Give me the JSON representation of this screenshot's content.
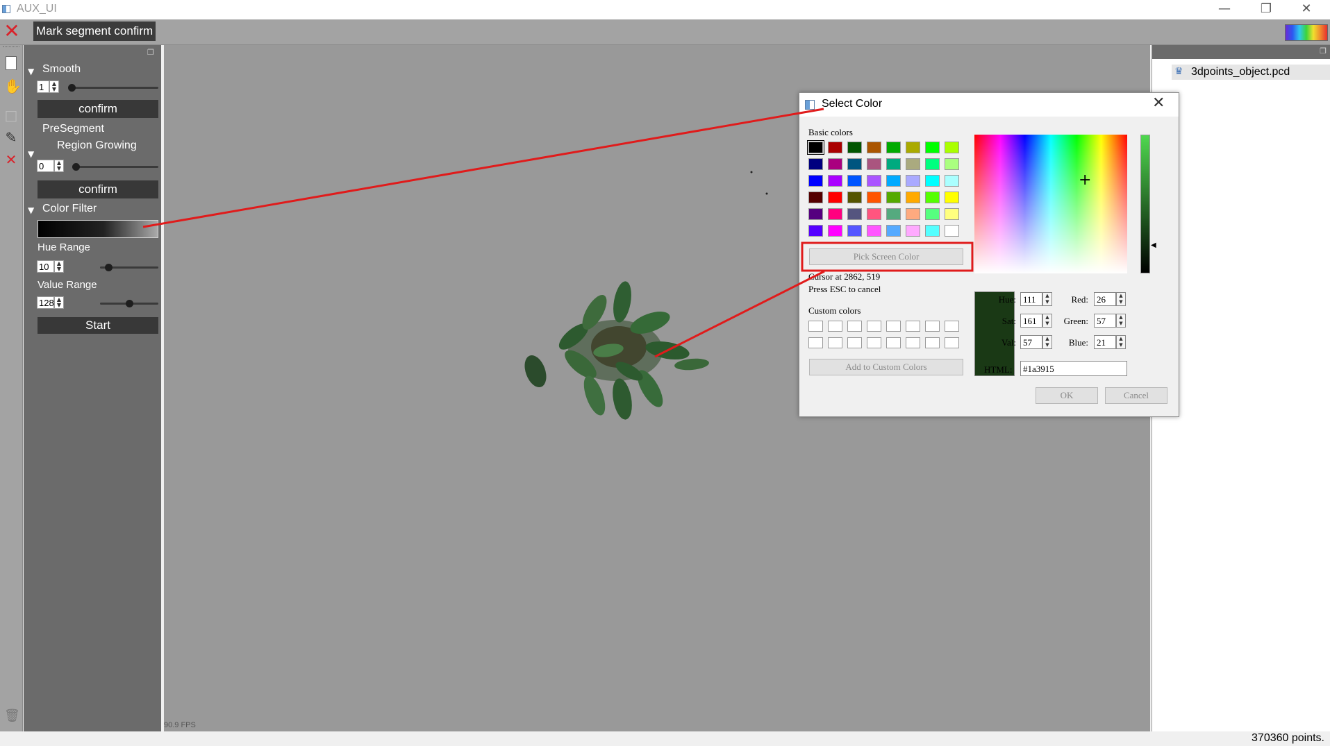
{
  "window": {
    "title": "AUX_UI",
    "minimize_icon": "minimize-icon",
    "maximize_icon": "restore-icon",
    "close_icon": "close-icon"
  },
  "toolbar": {
    "close_icon": "close-icon",
    "mark_label": "Mark segment confirm",
    "colormap_icon": "rainbow-colormap-icon"
  },
  "left_panel": {
    "smooth": {
      "title": "Smooth",
      "value": "1",
      "button": "confirm",
      "slider_fraction": 0.0
    },
    "presegment": {
      "title": "PreSegment",
      "method": "Region Growing",
      "value": "0",
      "button": "confirm",
      "slider_fraction": 0.0
    },
    "color_filter": {
      "title": "Color Filter",
      "hue_label": "Hue Range",
      "hue_value": "10",
      "hue_fraction": 0.1,
      "value_label": "Value Range",
      "value_value": "128",
      "value_fraction": 0.5,
      "start_button": "Start"
    }
  },
  "viewport": {
    "fps": "90.9 FPS"
  },
  "right_panel": {
    "file_name": "3dpoints_object.pcd"
  },
  "status": {
    "points": "370360 points."
  },
  "dialog": {
    "title": "Select Color",
    "basic_colors_label": "Basic colors",
    "basic_colors": [
      "#000000",
      "#aa0000",
      "#005500",
      "#aa5500",
      "#00aa00",
      "#aaaa00",
      "#00ff00",
      "#aaff00",
      "#00007f",
      "#aa007f",
      "#00557f",
      "#aa557f",
      "#00aa7f",
      "#aaaa7f",
      "#00ff7f",
      "#aaff7f",
      "#0000ff",
      "#aa00ff",
      "#0055ff",
      "#aa55ff",
      "#00aaff",
      "#aaaaff",
      "#00ffff",
      "#aaffff",
      "#550000",
      "#ff0000",
      "#555500",
      "#ff5500",
      "#55aa00",
      "#ffaa00",
      "#55ff00",
      "#ffff00",
      "#55007f",
      "#ff007f",
      "#55557f",
      "#ff557f",
      "#55aa7f",
      "#ffaa7f",
      "#55ff7f",
      "#ffff7f",
      "#5500ff",
      "#ff00ff",
      "#5555ff",
      "#ff55ff",
      "#55aaff",
      "#ffaaff",
      "#55ffff",
      "#ffffff"
    ],
    "pick_screen_label": "Pick Screen Color",
    "cursor_text": "Cursor at 2862, 519",
    "esc_text": "Press ESC to cancel",
    "custom_colors_label": "Custom colors",
    "add_custom_label": "Add to Custom Colors",
    "hue_label": "Hue:",
    "hue": "111",
    "sat_label": "Sat:",
    "sat": "161",
    "val_label": "Val:",
    "val": "57",
    "red_label": "Red:",
    "red": "26",
    "green_label": "Green:",
    "green": "57",
    "blue_label": "Blue:",
    "blue": "21",
    "html_label": "HTML:",
    "html": "#1a3915",
    "ok_label": "OK",
    "cancel_label": "Cancel",
    "current_color": "#1a3915"
  },
  "annotation_color": "#e01b1b"
}
